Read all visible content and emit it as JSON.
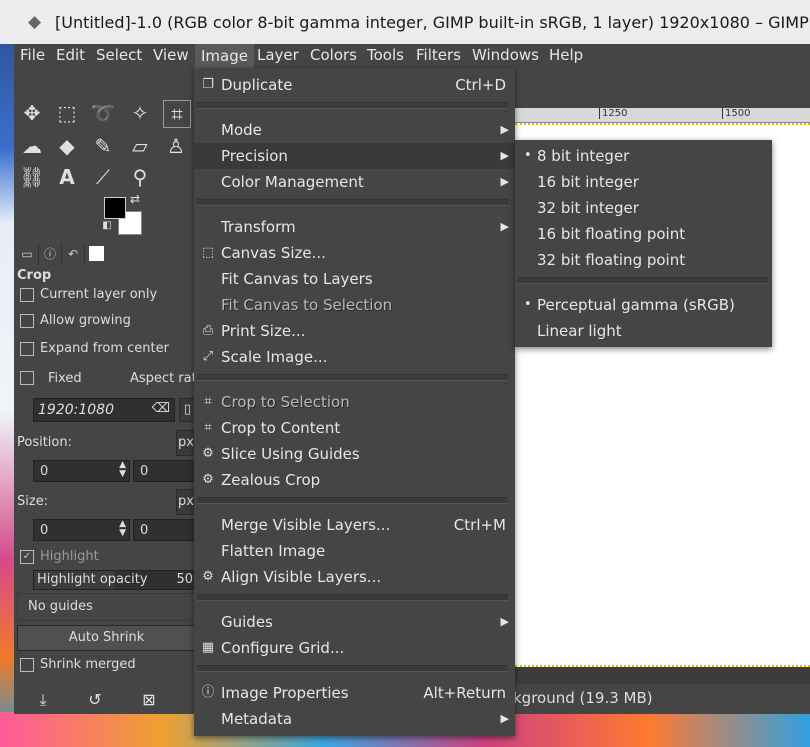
{
  "title_bar": {
    "title": "[Untitled]-1.0 (RGB color 8-bit gamma integer, GIMP built-in sRGB, 1 layer) 1920x1080 – GIMP"
  },
  "menubar": [
    "File",
    "Edit",
    "Select",
    "View",
    "Image",
    "Layer",
    "Colors",
    "Tools",
    "Filters",
    "Windows",
    "Help"
  ],
  "tool_options": {
    "heading": "Crop",
    "current_layer_only": "Current layer only",
    "allow_growing": "Allow growing",
    "expand_from_center": "Expand from center",
    "fixed": "Fixed",
    "aspect_ratio": "Aspect ratio",
    "ratio_value": "1920:1080",
    "position_label": "Position:",
    "position_unit": "px",
    "position_x": "0",
    "position_y": "0",
    "size_label": "Size:",
    "size_unit": "px",
    "size_x": "0",
    "size_y": "0",
    "highlight": "Highlight",
    "highlight_opacity": "Highlight opacity",
    "highlight_opacity_value": "50",
    "guides": "No guides",
    "auto_shrink": "Auto Shrink",
    "shrink_merged": "Shrink merged"
  },
  "image_menu": [
    {
      "label": "Duplicate",
      "accel": "Ctrl+D",
      "icon": "duplicate-icon"
    },
    {
      "label": "Mode",
      "submenu": true
    },
    {
      "label": "Precision",
      "submenu": true,
      "highlighted": true
    },
    {
      "label": "Color Management",
      "submenu": true
    },
    {
      "label": "Transform",
      "submenu": true
    },
    {
      "label": "Canvas Size...",
      "icon": "canvas-size-icon"
    },
    {
      "label": "Fit Canvas to Layers"
    },
    {
      "label": "Fit Canvas to Selection",
      "insensitive": true
    },
    {
      "label": "Print Size...",
      "icon": "print-icon"
    },
    {
      "label": "Scale Image...",
      "icon": "scale-icon"
    },
    {
      "label": "Crop to Selection",
      "icon": "crop-icon",
      "insensitive": true
    },
    {
      "label": "Crop to Content",
      "icon": "crop-icon"
    },
    {
      "label": "Slice Using Guides",
      "icon": "gear-icon"
    },
    {
      "label": "Zealous Crop",
      "icon": "gear-icon"
    },
    {
      "label": "Merge Visible Layers...",
      "accel": "Ctrl+M"
    },
    {
      "label": "Flatten Image"
    },
    {
      "label": "Align Visible Layers...",
      "icon": "gear-icon"
    },
    {
      "label": "Guides",
      "submenu": true
    },
    {
      "label": "Configure Grid...",
      "icon": "grid-icon"
    },
    {
      "label": "Image Properties",
      "accel": "Alt+Return",
      "icon": "info-icon"
    },
    {
      "label": "Metadata",
      "submenu": true
    }
  ],
  "precision_submenu": {
    "items": [
      "8 bit integer",
      "16 bit integer",
      "32 bit integer",
      "16 bit floating point",
      "32 bit floating point"
    ],
    "selected": "8 bit integer",
    "gamma": [
      "Perceptual gamma (sRGB)",
      "Linear light"
    ],
    "gamma_selected": "Perceptual gamma (sRGB)"
  },
  "ruler": {
    "marks": [
      "1250",
      "1500"
    ]
  },
  "status": {
    "layer": "kground (19.3 MB)"
  },
  "colors": {
    "accent_menu": "#454545",
    "highlight": "#3a3a3a",
    "selection_border": "#d8c000"
  }
}
